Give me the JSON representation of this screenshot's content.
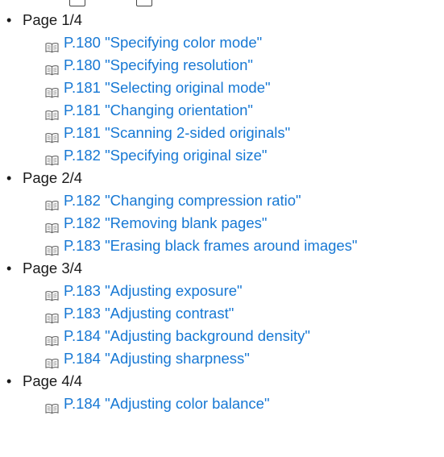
{
  "sections": [
    {
      "label": "Page 1/4",
      "refs": [
        {
          "page": "P.180",
          "title": "\"Specifying color mode\""
        },
        {
          "page": "P.180",
          "title": "\"Specifying resolution\""
        },
        {
          "page": "P.181",
          "title": "\"Selecting original mode\""
        },
        {
          "page": "P.181",
          "title": "\"Changing orientation\""
        },
        {
          "page": "P.181",
          "title": "\"Scanning 2-sided originals\""
        },
        {
          "page": "P.182",
          "title": "\"Specifying original size\""
        }
      ]
    },
    {
      "label": "Page 2/4",
      "refs": [
        {
          "page": "P.182",
          "title": "\"Changing compression ratio\""
        },
        {
          "page": "P.182",
          "title": "\"Removing blank pages\""
        },
        {
          "page": "P.183",
          "title": "\"Erasing black frames around images\""
        }
      ]
    },
    {
      "label": "Page 3/4",
      "refs": [
        {
          "page": "P.183",
          "title": "\"Adjusting exposure\""
        },
        {
          "page": "P.183",
          "title": "\"Adjusting contrast\""
        },
        {
          "page": "P.184",
          "title": "\"Adjusting background density\""
        },
        {
          "page": "P.184",
          "title": "\"Adjusting sharpness\""
        }
      ]
    },
    {
      "label": "Page 4/4",
      "refs": [
        {
          "page": "P.184",
          "title": "\"Adjusting color balance\""
        }
      ]
    }
  ],
  "icons": {
    "bullet": "bullet-dot",
    "reference": "open-book-icon"
  },
  "colors": {
    "link": "#1778d4",
    "text": "#1a1a1a"
  }
}
